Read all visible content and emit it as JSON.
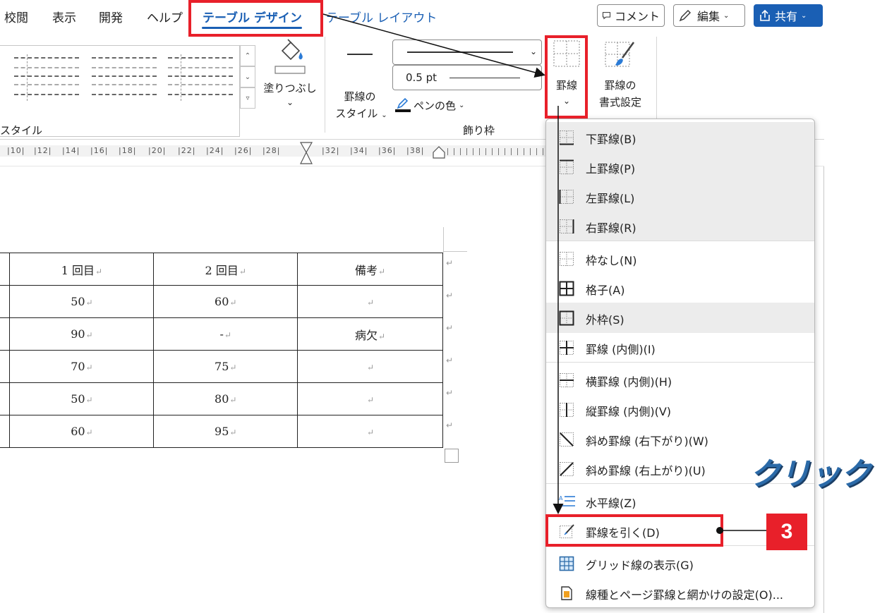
{
  "tabs": {
    "review": "校閲",
    "view": "表示",
    "developer": "開発",
    "help": "ヘルプ",
    "table_design": "テーブル デザイン",
    "table_layout": "テーブル レイアウト"
  },
  "header_buttons": {
    "comment": "コメント",
    "edit": "編集",
    "share": "共有"
  },
  "ribbon": {
    "shading_label": "塗りつぶし",
    "styles_group_label": "スタイル",
    "border_style_label1": "罫線の",
    "border_style_label2": "スタイル",
    "line_weight_value": "0.5 pt",
    "pen_color_label": "ペンの色",
    "borders_group_label": "飾り枠",
    "borders_button_label": "罫線",
    "border_painter_label1": "罫線の",
    "border_painter_label2": "書式設定"
  },
  "ruler_numbers": [
    "|10|",
    "|12|",
    "|14|",
    "|16|",
    "|18|",
    "|20|",
    "|22|",
    "|24|",
    "|26|",
    "|28|",
    "|32|",
    "|34|",
    "|36|",
    "|38|"
  ],
  "table": {
    "rows": [
      [
        "1 回目",
        "2 回目",
        "備考"
      ],
      [
        "50",
        "60",
        ""
      ],
      [
        "90",
        "-",
        "病欠"
      ],
      [
        "70",
        "75",
        ""
      ],
      [
        "50",
        "80",
        ""
      ],
      [
        "60",
        "95",
        ""
      ]
    ]
  },
  "borders_menu": {
    "items": [
      {
        "label": "下罫線(B)",
        "icon": "bottom-border-icon",
        "highlight": true
      },
      {
        "label": "上罫線(P)",
        "icon": "top-border-icon",
        "highlight": true
      },
      {
        "label": "左罫線(L)",
        "icon": "left-border-icon",
        "highlight": true
      },
      {
        "label": "右罫線(R)",
        "icon": "right-border-icon",
        "highlight": true
      },
      {
        "label": "枠なし(N)",
        "icon": "no-border-icon",
        "highlight": false
      },
      {
        "label": "格子(A)",
        "icon": "all-borders-icon",
        "highlight": false
      },
      {
        "label": "外枠(S)",
        "icon": "outside-borders-icon",
        "highlight": true
      },
      {
        "label": "罫線 (内側)(I)",
        "icon": "inside-borders-icon",
        "highlight": false
      },
      {
        "label": "横罫線 (内側)(H)",
        "icon": "inside-horizontal-border-icon",
        "highlight": false
      },
      {
        "label": "縦罫線 (内側)(V)",
        "icon": "inside-vertical-border-icon",
        "highlight": false
      },
      {
        "label": "斜め罫線 (右下がり)(W)",
        "icon": "diagonal-down-border-icon",
        "highlight": false
      },
      {
        "label": "斜め罫線 (右上がり)(U)",
        "icon": "diagonal-up-border-icon",
        "highlight": false
      },
      {
        "label": "水平線(Z)",
        "icon": "horizontal-line-icon",
        "highlight": false
      },
      {
        "label": "罫線を引く(D)",
        "icon": "draw-table-icon",
        "highlight": false
      },
      {
        "label": "グリッド線の表示(G)",
        "icon": "view-gridlines-icon",
        "highlight": false
      },
      {
        "label": "線種とページ罫線と網かけの設定(O)...",
        "icon": "borders-and-shading-icon",
        "highlight": false
      }
    ]
  },
  "annotations": {
    "step_number": "3",
    "click_label": "クリック",
    "highlight_color": "#e8202a",
    "accent_color": "#1a5fb4"
  }
}
